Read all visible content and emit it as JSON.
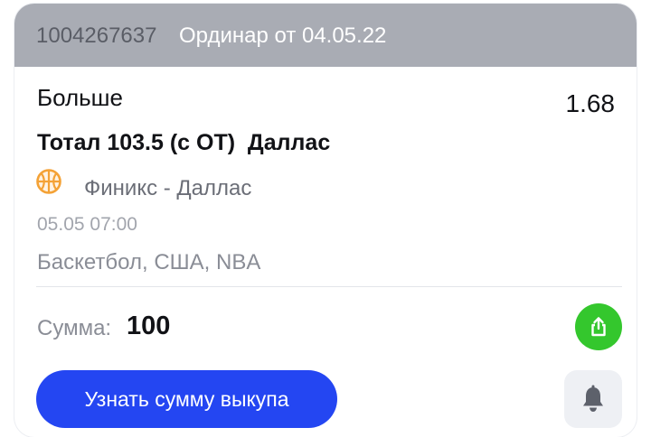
{
  "header": {
    "bet_id": "1004267637",
    "bet_type": "Ординар от 04.05.22"
  },
  "bet": {
    "outcome": "Больше",
    "odds": "1.68",
    "market": "Тотал 103.5 (с ОТ)  Даллас",
    "sport_icon": "basketball-icon",
    "match": "Финикс - Даллас",
    "datetime": "05.05 07:00",
    "league": "Баскетбол, США, NBA"
  },
  "summary": {
    "sum_label": "Сумма:",
    "sum_value": "100"
  },
  "actions": {
    "share_icon": "share-icon",
    "buyout_label": "Узнать сумму выкупа",
    "bell_icon": "bell-icon"
  },
  "colors": {
    "header_bg": "#a9acb4",
    "share_green": "#34c72d",
    "primary_blue": "#2446f2",
    "ball_orange": "#f4a236"
  }
}
